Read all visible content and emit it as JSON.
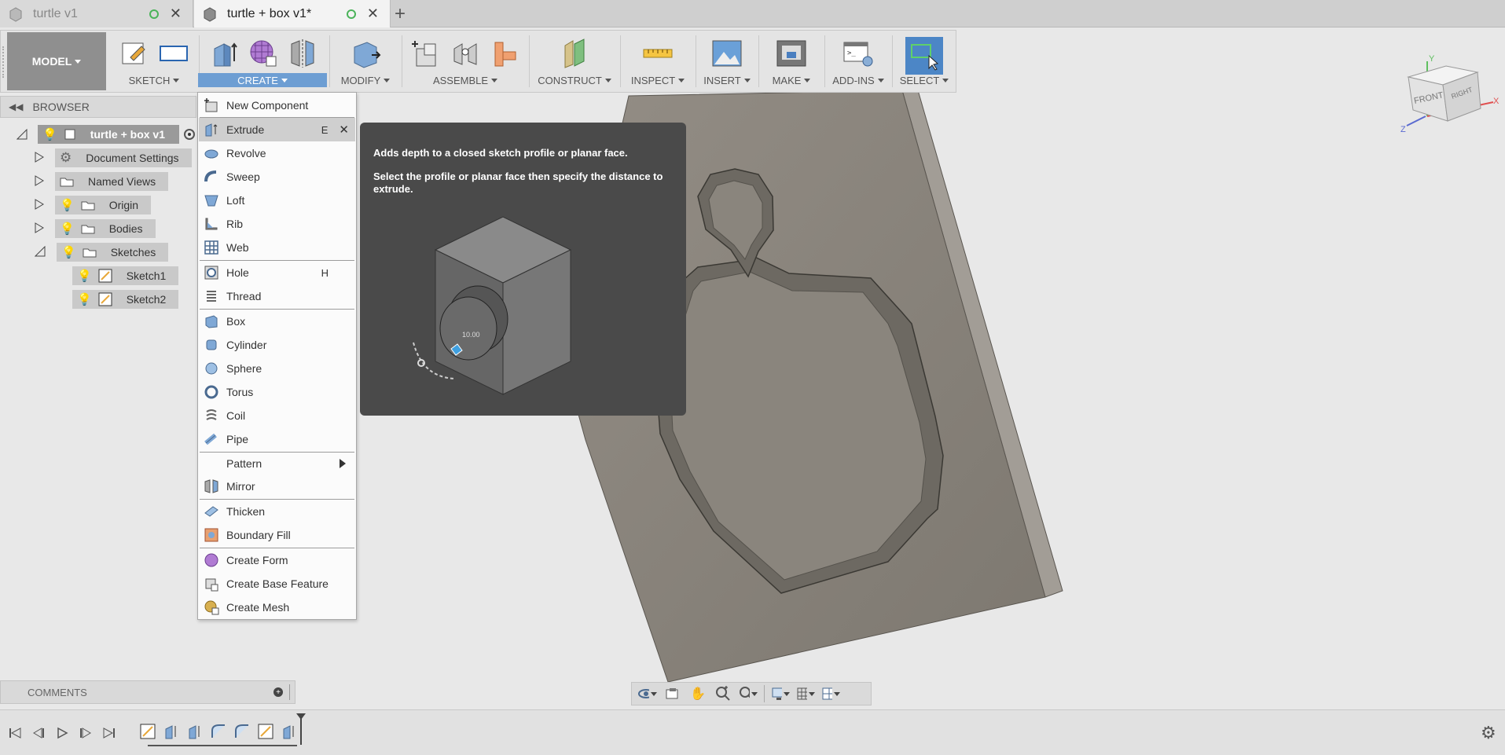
{
  "tabs": [
    {
      "label": "turtle v1",
      "active": false
    },
    {
      "label": "turtle + box v1*",
      "active": true
    }
  ],
  "toolbar": {
    "workspace": "MODEL",
    "groups": {
      "sketch": "SKETCH",
      "create": "CREATE",
      "modify": "MODIFY",
      "assemble": "ASSEMBLE",
      "construct": "CONSTRUCT",
      "inspect": "INSPECT",
      "insert": "INSERT",
      "make": "MAKE",
      "addins": "ADD-INS",
      "select": "SELECT"
    }
  },
  "browser": {
    "title": "BROWSER",
    "root": "turtle + box v1",
    "items": {
      "document_settings": "Document Settings",
      "named_views": "Named Views",
      "origin": "Origin",
      "bodies": "Bodies",
      "sketches": "Sketches",
      "sketch1": "Sketch1",
      "sketch2": "Sketch2"
    }
  },
  "create_menu": {
    "new_component": "New Component",
    "extrude": "Extrude",
    "extrude_shortcut": "E",
    "revolve": "Revolve",
    "sweep": "Sweep",
    "loft": "Loft",
    "rib": "Rib",
    "web": "Web",
    "hole": "Hole",
    "hole_shortcut": "H",
    "thread": "Thread",
    "box": "Box",
    "cylinder": "Cylinder",
    "sphere": "Sphere",
    "torus": "Torus",
    "coil": "Coil",
    "pipe": "Pipe",
    "pattern": "Pattern",
    "mirror": "Mirror",
    "thicken": "Thicken",
    "boundary_fill": "Boundary Fill",
    "create_form": "Create Form",
    "create_base_feature": "Create Base Feature",
    "create_mesh": "Create Mesh"
  },
  "tooltip": {
    "title": "Adds depth to a closed sketch profile or planar face.",
    "body": "Select the profile or planar face then specify the distance to extrude.",
    "dimension": "10.00"
  },
  "viewcube": {
    "front": "FRONT",
    "right": "RIGHT",
    "x": "X",
    "y": "Y",
    "z": "Z"
  },
  "comments": {
    "title": "COMMENTS"
  },
  "colors": {
    "accent": "#6d9ed3",
    "model_face": "#8a857d",
    "tooltip_bg": "#4a4a4a"
  }
}
